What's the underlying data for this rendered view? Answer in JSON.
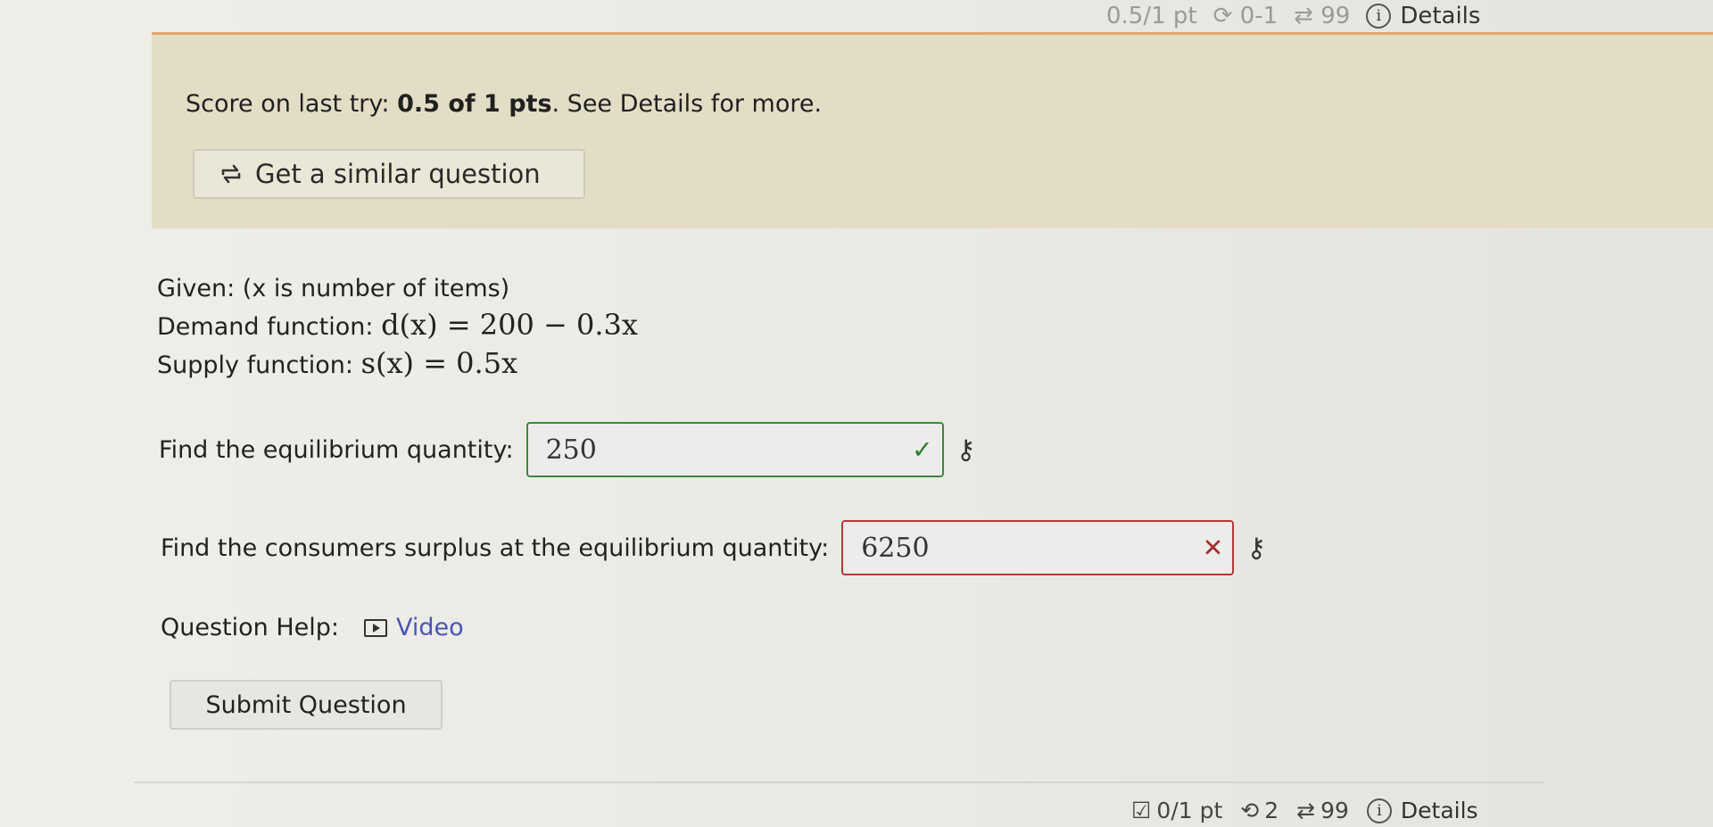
{
  "top_bar": {
    "score": "0.5/1 pt",
    "tries": "0-1",
    "similar_count": "99",
    "details_label": "Details"
  },
  "banner": {
    "prefix": "Score on last try: ",
    "score": "0.5 of 1 pts",
    "suffix": ". See Details for more.",
    "similar_button": "Get a similar question"
  },
  "question": {
    "given": "Given: (x is number of items)",
    "demand_label": "Demand function: ",
    "demand_expr": "d(x) = 200 − 0.3x",
    "supply_label": "Supply function: ",
    "supply_expr": "s(x) = 0.5x",
    "q1_label": "Find the equilibrium quantity:",
    "q1_value": "250",
    "q2_label": "Find the consumers surplus at the equilibrium quantity:",
    "q2_value": "6250"
  },
  "help": {
    "label": "Question Help:",
    "video_label": "Video"
  },
  "submit_label": "Submit Question",
  "bottom_bar": {
    "score": "0/1 pt",
    "tries": "2",
    "similar_count": "99",
    "details_label": "Details"
  },
  "colors": {
    "banner_bg": "#e3ddc5",
    "correct": "#3c8a3c",
    "incorrect": "#b33a36",
    "link": "#4a54b8"
  },
  "icons": {
    "retry": "refresh-icon",
    "similar": "cycle-arrows-icon",
    "info": "info-icon",
    "correct": "check-icon",
    "incorrect": "x-icon",
    "key": "key-icon",
    "video": "video-icon",
    "checkbox": "checkbox-icon"
  }
}
